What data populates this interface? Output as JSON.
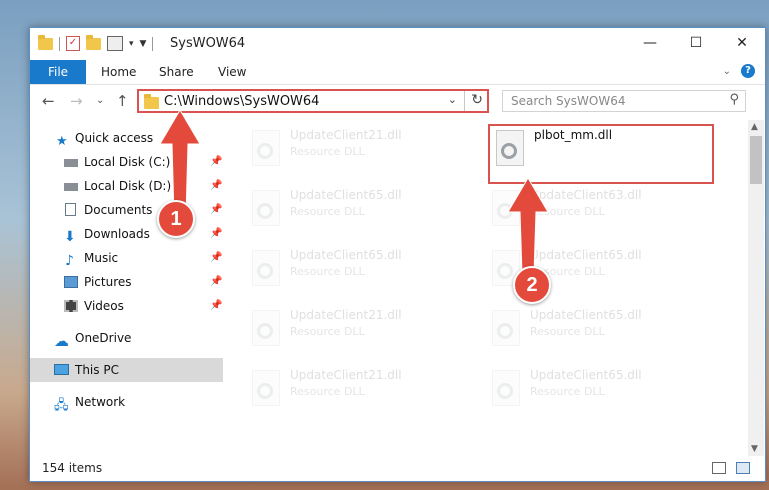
{
  "window": {
    "title": "SysWOW64",
    "controls": {
      "minimize": "—",
      "maximize": "☐",
      "close": "✕"
    }
  },
  "ribbon": {
    "tabs": [
      "File",
      "Home",
      "Share",
      "View"
    ],
    "expand_icon": "chevron-down-icon",
    "help": "?"
  },
  "address": {
    "path": "C:\\Windows\\SysWOW64",
    "search_placeholder": "Search SysWOW64"
  },
  "sidebar": {
    "quick_access": "Quick access",
    "items": [
      {
        "label": "Local Disk (C:)",
        "pinned": true
      },
      {
        "label": "Local Disk (D:)",
        "pinned": true
      },
      {
        "label": "Documents",
        "pinned": true
      },
      {
        "label": "Downloads",
        "pinned": true
      },
      {
        "label": "Music",
        "pinned": true
      },
      {
        "label": "Pictures",
        "pinned": true
      },
      {
        "label": "Videos",
        "pinned": true
      }
    ],
    "onedrive": "OneDrive",
    "this_pc": "This PC",
    "network": "Network"
  },
  "files": [
    {
      "name": "UpdateClient21.dll",
      "type": "Resource DLL"
    },
    {
      "name": "plbot_mm.dll",
      "type": ""
    },
    {
      "name": "UpdateClient65.dll",
      "type": "Resource DLL"
    },
    {
      "name": "UpdateClient63.dll",
      "type": "Resource DLL"
    },
    {
      "name": "UpdateClient65.dll",
      "type": "Resource DLL"
    },
    {
      "name": "UpdateClient65.dll",
      "type": "Resource DLL"
    },
    {
      "name": "UpdateClient21.dll",
      "type": "Resource DLL"
    },
    {
      "name": "UpdateClient65.dll",
      "type": "Resource DLL"
    },
    {
      "name": "UpdateClient21.dll",
      "type": "Resource DLL"
    },
    {
      "name": "UpdateClient65.dll",
      "type": "Resource DLL"
    }
  ],
  "status": {
    "item_count": "154 items"
  },
  "annotations": {
    "step1": "1",
    "step2": "2",
    "color": "#e44a3c"
  }
}
